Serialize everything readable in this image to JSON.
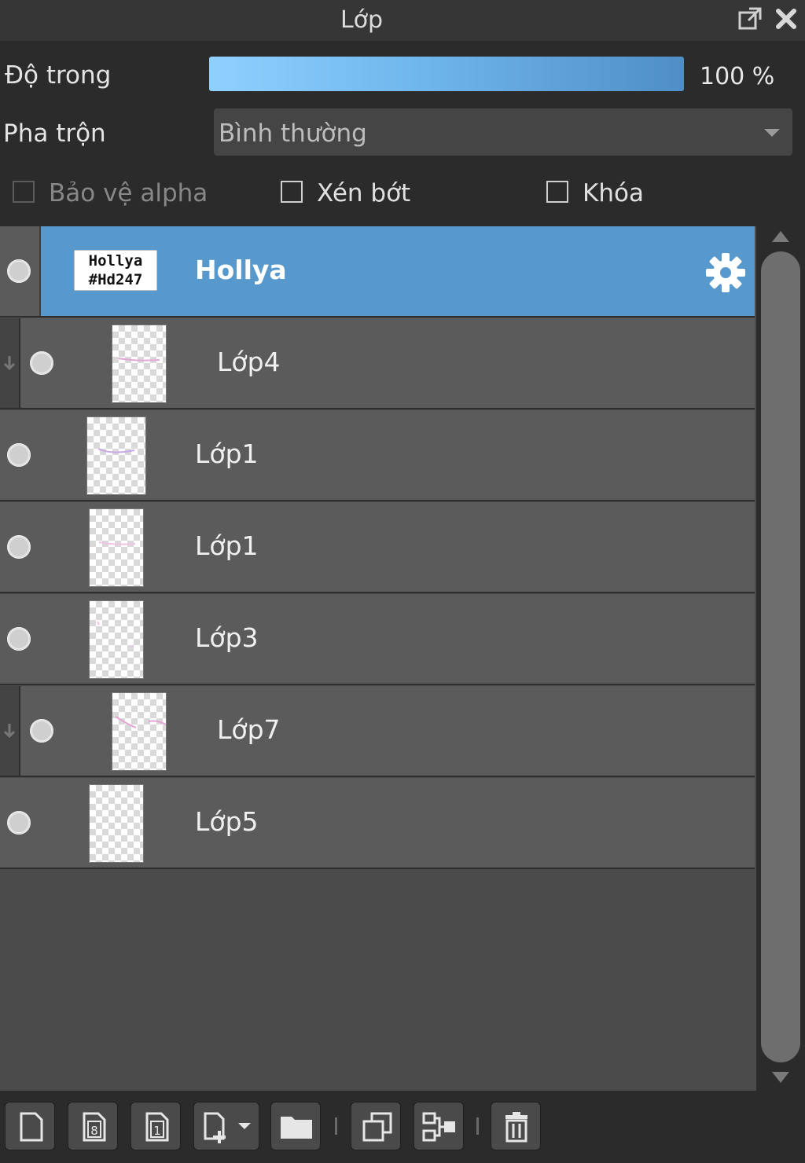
{
  "panel": {
    "title": "Lớp"
  },
  "opacity": {
    "label": "Độ trong",
    "value_text": "100 %",
    "fraction": 1.0
  },
  "blend": {
    "label": "Pha trộn",
    "value": "Bình thường"
  },
  "options": [
    {
      "label": "Bảo vệ alpha",
      "checked": false,
      "enabled": false
    },
    {
      "label": "Xén bớt",
      "checked": false,
      "enabled": true
    },
    {
      "label": "Khóa",
      "checked": false,
      "enabled": true
    }
  ],
  "layers": [
    {
      "name": "Hollya",
      "selected": true,
      "clipped": false,
      "thumb_text_line1": "Hollya",
      "thumb_text_line2": "#Hd247"
    },
    {
      "name": "Lớp4",
      "selected": false,
      "clipped": true
    },
    {
      "name": "Lớp1",
      "selected": false,
      "clipped": false
    },
    {
      "name": "Lớp1",
      "selected": false,
      "clipped": false
    },
    {
      "name": "Lớp3",
      "selected": false,
      "clipped": false
    },
    {
      "name": "Lớp7",
      "selected": false,
      "clipped": true
    },
    {
      "name": "Lớp5",
      "selected": false,
      "clipped": false
    }
  ],
  "toolbar": {
    "icons": [
      "new-layer-icon",
      "new-8bit-layer-icon",
      "new-1bit-layer-icon",
      "add-layer-menu-icon",
      "new-folder-icon",
      "duplicate-layer-icon",
      "merge-down-icon",
      "delete-layer-icon"
    ]
  },
  "colors": {
    "selected_row": "#5799cd",
    "row": "#5b5b5b",
    "opacity_fill_start": "#8fd0ff",
    "opacity_fill_end": "#4f8ec6"
  }
}
